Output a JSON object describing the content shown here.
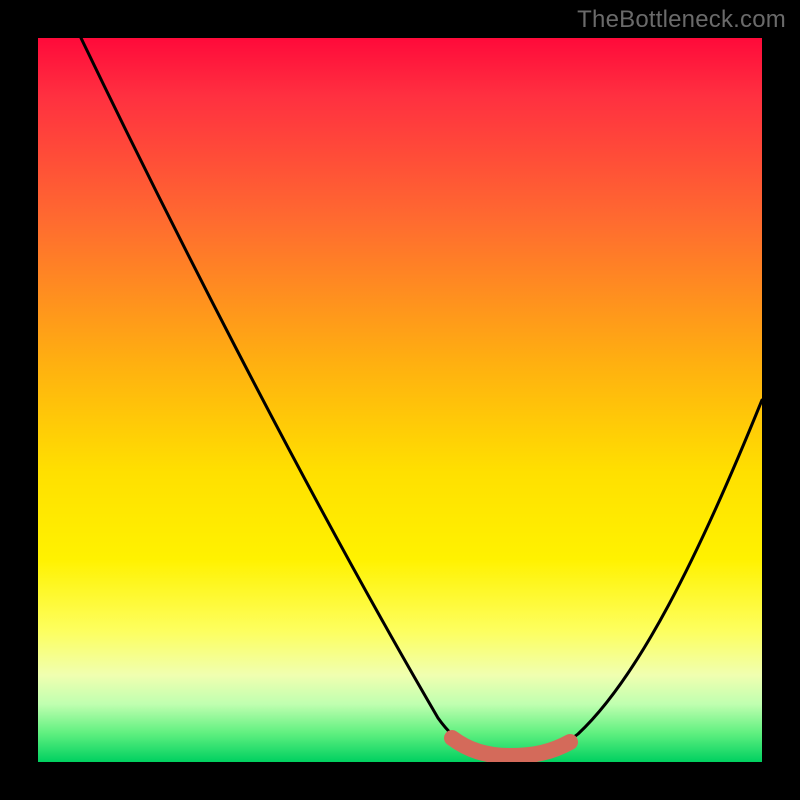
{
  "watermark": "TheBottleneck.com",
  "chart_data": {
    "type": "line",
    "title": "",
    "xlabel": "",
    "ylabel": "",
    "xlim": [
      0,
      100
    ],
    "ylim": [
      0,
      100
    ],
    "grid": false,
    "series": [
      {
        "name": "curve",
        "color": "#000000",
        "x": [
          6,
          10,
          15,
          20,
          25,
          30,
          35,
          40,
          45,
          50,
          55,
          58,
          60,
          63,
          66,
          69,
          72,
          75,
          80,
          85,
          90,
          95,
          100
        ],
        "y": [
          100,
          93,
          84,
          75,
          66,
          57,
          48,
          40,
          31,
          22,
          13,
          8,
          5,
          3,
          2,
          2,
          2,
          3,
          9,
          18,
          28,
          39,
          50
        ]
      },
      {
        "name": "highlight",
        "color": "#d46a5a",
        "x": [
          58,
          60,
          63,
          66,
          69,
          72,
          75
        ],
        "y": [
          4,
          3,
          2.2,
          2,
          2,
          2.2,
          3
        ]
      }
    ],
    "background_gradient": {
      "top": "#ff0a3a",
      "mid": "#ffe000",
      "bottom": "#00d060"
    }
  }
}
